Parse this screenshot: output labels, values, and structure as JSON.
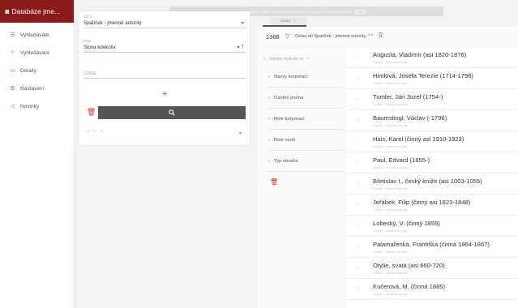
{
  "app": {
    "title": "Databáze jme...",
    "logo": "ııı"
  },
  "sidebar": {
    "items": [
      {
        "label": "Vyhledávání",
        "icon": "search-icon"
      },
      {
        "label": "Detaily",
        "icon": "window-icon"
      },
      {
        "label": "Nastavení",
        "icon": "gear-icon"
      },
      {
        "label": "Novinky",
        "icon": "megaphone-icon"
      }
    ],
    "first_item": {
      "label": "Vyhledáváte",
      "icon": "list-icon"
    }
  },
  "form": {
    "source": {
      "label": "Zdroj",
      "value": "Spalíček - jmenné autority"
    },
    "field": {
      "label": "Pole",
      "value": "Slova kdekoliv"
    },
    "query": {
      "placeholder": "Dotaz"
    },
    "small_icons": "+ ⊢ ✎"
  },
  "top_strip": {
    "text": "Ladění je aktivní. Informace o ladění jsou k dispozici v konzoli prohlížeče",
    "tab_label": "Dotaz",
    "close": "×"
  },
  "results_header": {
    "count": "1368",
    "query_text": "Dotaz do Spalíček - jmenné autority: * *"
  },
  "facets": {
    "search_placeholder": "Zadejte hodnotu vý",
    "items": [
      "Názvy korporací",
      "Osobní jména",
      "Role korporací",
      "Role osob",
      "Typ obsahu"
    ]
  },
  "results": [
    {
      "title": "Augusta, Vladimír (asi 1820-1876)",
      "sub": "Osobní · Jmenné autority"
    },
    {
      "title": "Himlová, Josefa Terezie (1714-1798)",
      "sub": "Osobní · Jmenné autority"
    },
    {
      "title": "Tumler, Ján Jozef (1754-)",
      "sub": "Osobní · Jmenné autority"
    },
    {
      "title": "Baumstingl, Václav (-1796)",
      "sub": "Osobní · Jmenné autority"
    },
    {
      "title": "Hais, Karel (činný asi 1910-1923)",
      "sub": "Osobní · Jmenné autority"
    },
    {
      "title": "Paul, Edvard (1855-)",
      "sub": "Osobní · Jmenné autority"
    },
    {
      "title": "Břetislav I., český kníže (asi 1003-1055)",
      "sub": "Osobní · Jmenné autority"
    },
    {
      "title": "Jeřábek, Filip (činný asi 1823-1848)",
      "sub": "Osobní · Jmenné autority"
    },
    {
      "title": "Lobeský, V. (činný 1859)",
      "sub": "Osobní · Jmenné autority"
    },
    {
      "title": "Palamařenka, Františka (činná 1864-1867)",
      "sub": "Osobní · Jmenné autority"
    },
    {
      "title": "Otylie, svatá (asi 660-720)",
      "sub": "Osobní · Jmenné autority"
    },
    {
      "title": "Kučerová, M. (činná 1885)",
      "sub": "Osobní · Jmenné autority"
    }
  ],
  "colors": {
    "brand": "#8b1a1a",
    "danger": "#d32f2f",
    "button": "#555555"
  }
}
